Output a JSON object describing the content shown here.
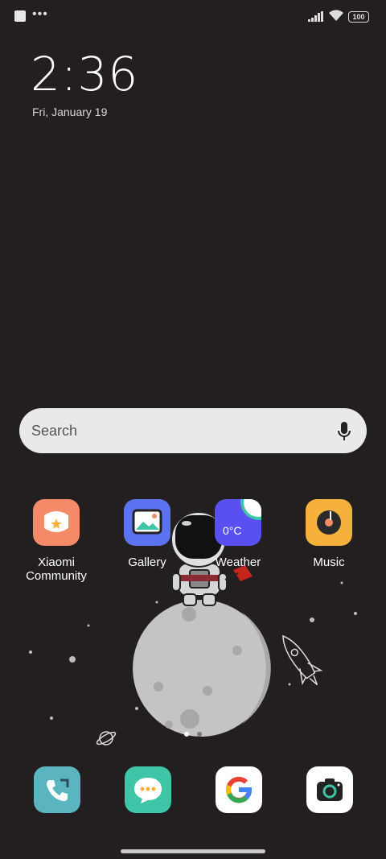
{
  "status": {
    "battery": "100"
  },
  "lock": {
    "time": "2:36",
    "date": "Fri, January 19"
  },
  "search": {
    "placeholder": "Search"
  },
  "apps": [
    {
      "label": "Xiaomi Community",
      "icon": "xiaomi-community-icon",
      "color": "#f58a68"
    },
    {
      "label": "Gallery",
      "icon": "gallery-icon",
      "color": "#5b73f0"
    },
    {
      "label": "Weather",
      "icon": "weather-icon",
      "color": "#5a4ff0",
      "temp": "0°C"
    },
    {
      "label": "Music",
      "icon": "music-icon",
      "color": "#f6b13c"
    }
  ],
  "dock": [
    {
      "icon": "phone-icon",
      "color": "#5bb5c0"
    },
    {
      "icon": "messages-icon",
      "color": "#3ec4a6"
    },
    {
      "icon": "google-icon",
      "color": "#ffffff"
    },
    {
      "icon": "camera-icon",
      "color": "#ffffff"
    }
  ]
}
